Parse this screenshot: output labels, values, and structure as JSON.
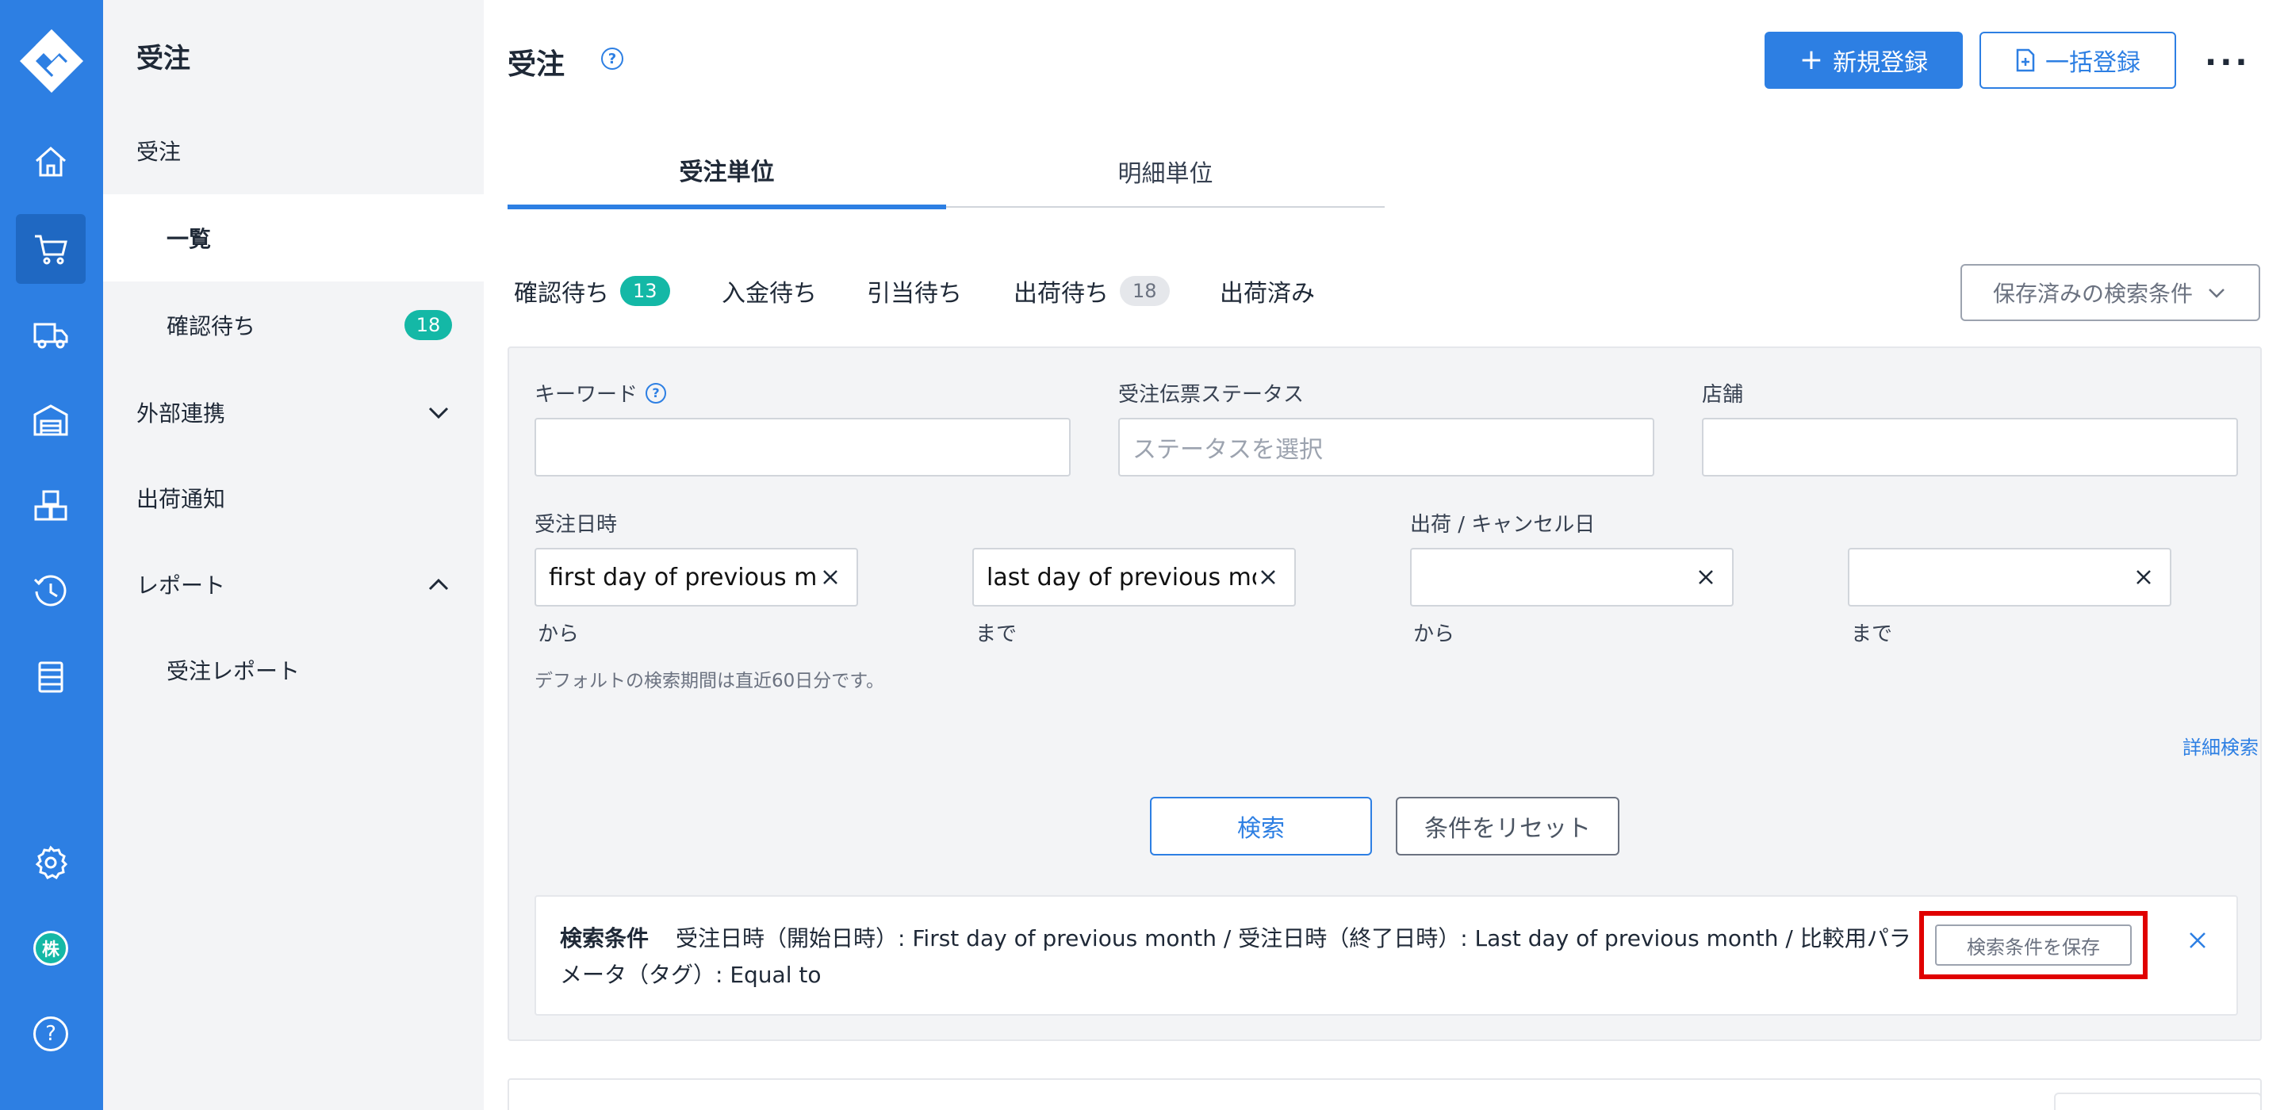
{
  "sidebar": {
    "title": "受注",
    "items": [
      {
        "label": "受注"
      },
      {
        "label": "一覧"
      },
      {
        "label": "確認待ち",
        "badge": "18"
      },
      {
        "label": "外部連携"
      },
      {
        "label": "出荷通知"
      },
      {
        "label": "レポート"
      },
      {
        "label": "受注レポート"
      }
    ]
  },
  "rail": {
    "icons": [
      "logo-icon",
      "home-icon",
      "cart-icon",
      "truck-icon",
      "warehouse-icon",
      "boxes-icon",
      "history-icon",
      "list-icon",
      "gear-icon",
      "company-avatar",
      "help-icon"
    ],
    "avatar_label": "株",
    "help_label": "?"
  },
  "header": {
    "title": "受注",
    "help": "?",
    "new_button": "新規登録",
    "bulk_button": "一括登録",
    "more": "···"
  },
  "tabs": [
    {
      "label": "受注単位",
      "active": true
    },
    {
      "label": "明細単位",
      "active": false
    }
  ],
  "filter_tabs": [
    {
      "label": "確認待ち",
      "badge": "13"
    },
    {
      "label": "入金待ち"
    },
    {
      "label": "引当待ち"
    },
    {
      "label": "出荷待ち",
      "badge": "18"
    },
    {
      "label": "出荷済み"
    }
  ],
  "saved_search": {
    "label": "保存済みの検索条件"
  },
  "form": {
    "keyword": {
      "label": "キーワード",
      "help": "?",
      "value": ""
    },
    "status": {
      "label": "受注伝票ステータス",
      "placeholder": "ステータスを選択"
    },
    "store": {
      "label": "店舗",
      "value": ""
    },
    "order_date": {
      "label": "受注日時",
      "from_value": "first day of previous mo",
      "to_value": "last day of previous mor",
      "from_label": "から",
      "to_label": "まで"
    },
    "ship_date": {
      "label": "出荷 / キャンセル日",
      "from_value": "",
      "to_value": "",
      "from_label": "から",
      "to_label": "まで"
    },
    "hint": "デフォルトの検索期間は直近60日分です。",
    "advanced": "詳細検索",
    "search_button": "検索",
    "reset_button": "条件をリセット"
  },
  "criteria": {
    "title": "検索条件",
    "text": "受注日時（開始日時）: First day of previous month / 受注日時（終了日時）: Last day of previous month / 比較用パラメータ（タグ）: Equal to",
    "save_button": "検索条件を保存"
  },
  "colors": {
    "primary": "#2d7fe3",
    "teal": "#14b8a6",
    "highlight": "#e00000"
  }
}
